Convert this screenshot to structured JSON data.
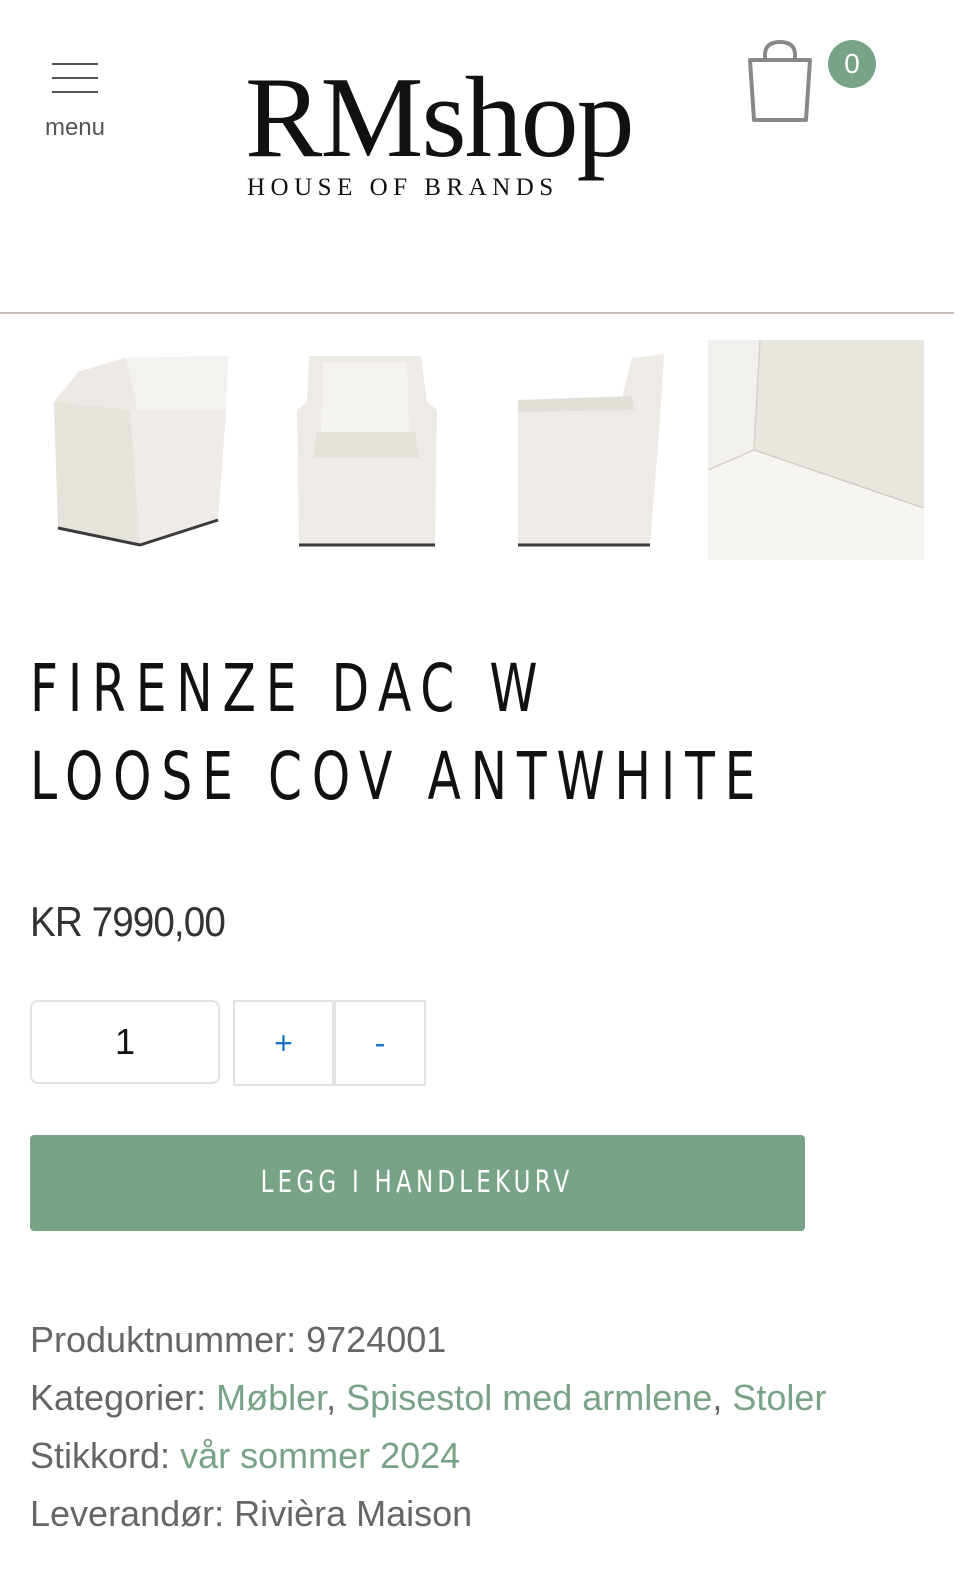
{
  "header": {
    "menu_label": "menu",
    "logo_wordmark": "RMshop",
    "logo_tagline": "HOUSE OF BRANDS",
    "cart_count": "0"
  },
  "gallery": {
    "thumbnails": [
      {
        "icon": "chair-angled-view"
      },
      {
        "icon": "chair-front-view"
      },
      {
        "icon": "chair-side-view"
      },
      {
        "icon": "fabric-detail-view"
      }
    ]
  },
  "product": {
    "title": "FIRENZE DAC W LOOSE COV ANTWHITE",
    "price": "KR 7990,00",
    "quantity": "1",
    "plus_label": "+",
    "minus_label": "-",
    "add_to_cart_label": "LEGG I HANDLEKURV"
  },
  "meta": {
    "sku_label": "Produktnummer:",
    "sku_value": "9724001",
    "categories_label": "Kategorier:",
    "categories": [
      "Møbler",
      "Spisestol med armlene",
      "Stoler"
    ],
    "tags_label": "Stikkord:",
    "tags": [
      "vår sommer 2024"
    ],
    "supplier_label": "Leverandør:",
    "supplier_value": "Rivièra Maison"
  },
  "colors": {
    "accent": "#78a386",
    "link": "#78a386",
    "stepper": "#1a73c8"
  }
}
